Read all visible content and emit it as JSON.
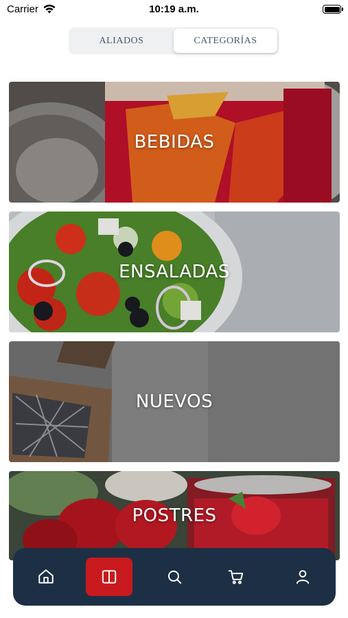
{
  "status_bar": {
    "carrier": "Carrier",
    "time": "10:19 a.m."
  },
  "segmented": {
    "left_label": "ALIADOS",
    "right_label": "CATEGORÍAS",
    "selected": "CATEGORÍAS"
  },
  "categories": [
    {
      "label": "BEBIDAS"
    },
    {
      "label": "ENSALADAS"
    },
    {
      "label": "NUEVOS"
    },
    {
      "label": "POSTRES"
    }
  ],
  "tabbar": {
    "items": [
      "home-icon",
      "categories-icon",
      "search-icon",
      "cart-icon",
      "profile-icon"
    ],
    "active": "categories-icon"
  },
  "colors": {
    "tabbar_bg": "#1d2f45",
    "active_tab": "#c81a1e",
    "segment_bg": "#eef0f2"
  }
}
